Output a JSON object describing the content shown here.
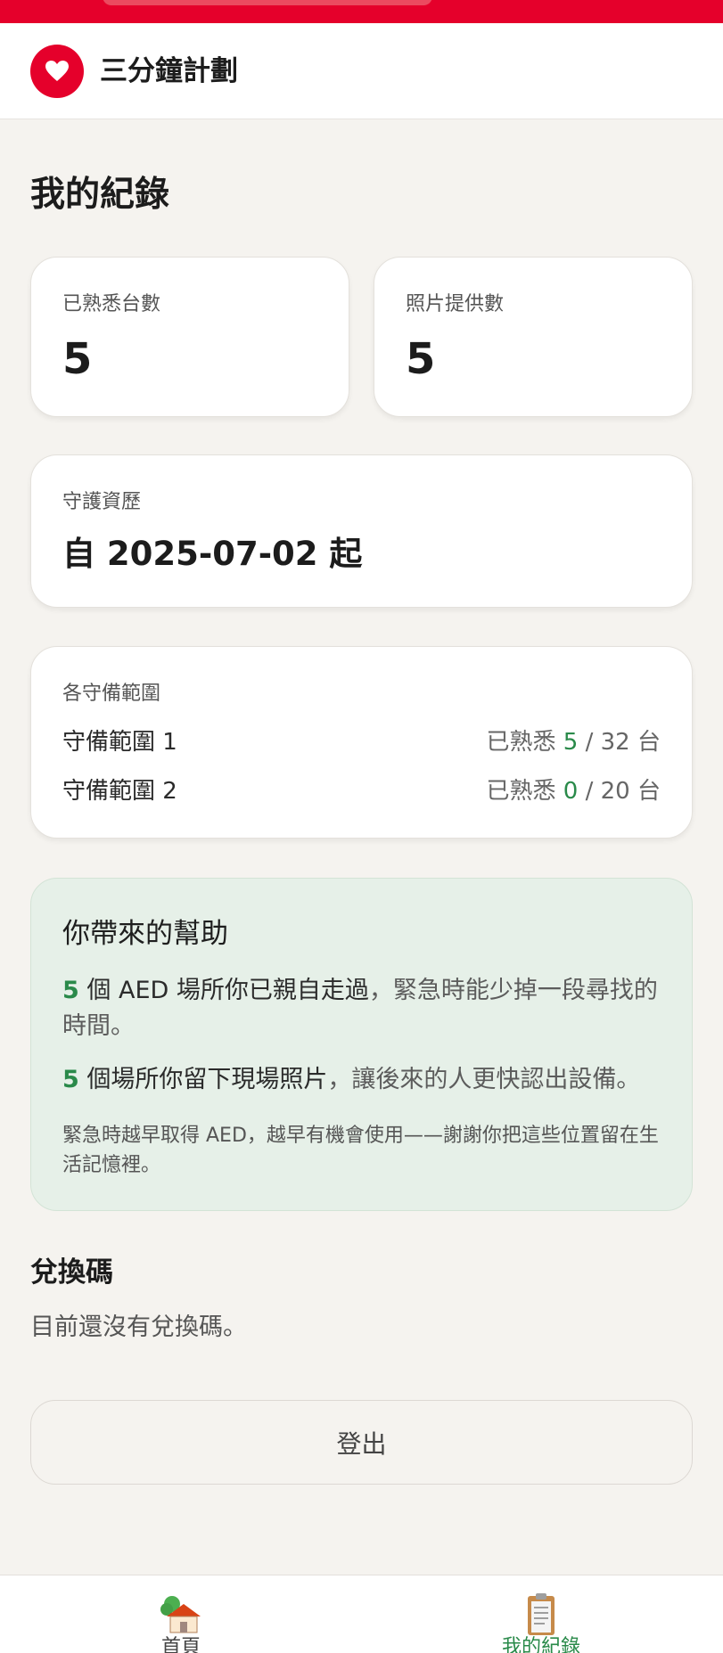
{
  "header": {
    "app_title": "三分鐘計劃"
  },
  "page": {
    "title": "我的紀錄"
  },
  "stats": {
    "familiar": {
      "label": "已熟悉台數",
      "value": "5"
    },
    "photos": {
      "label": "照片提供數",
      "value": "5"
    }
  },
  "guard": {
    "label": "守護資歷",
    "value": "自 2025-07-02 起"
  },
  "zones": {
    "label": "各守備範圍",
    "prefix": "已熟悉",
    "unit": "台",
    "items": [
      {
        "name": "守備範圍 1",
        "count": "5",
        "total": "/ 32"
      },
      {
        "name": "守備範圍 2",
        "count": "0",
        "total": "/ 20"
      }
    ]
  },
  "help": {
    "title": "你帶來的幫助",
    "line1": {
      "num": "5",
      "text_a": "個 AED 場所你已親自走過",
      "text_b": "，緊急時能少掉一段尋找的時間。"
    },
    "line2": {
      "num": "5",
      "text_a": "個場所你留下現場照片",
      "text_b": "，讓後來的人更快認出設備。"
    },
    "note": "緊急時越早取得 AED，越早有機會使用——謝謝你把這些位置留在生活記憶裡。"
  },
  "redeem": {
    "title": "兌換碼",
    "empty": "目前還沒有兌換碼。"
  },
  "logout_label": "登出",
  "nav": {
    "home": {
      "label": "首頁"
    },
    "records": {
      "label": "我的紀錄"
    }
  },
  "colors": {
    "brand": "#e5002b",
    "accent_green": "#2a8a4a",
    "help_bg": "#e6f0e8",
    "page_bg": "#f5f3ef"
  },
  "icons": {
    "logo": "heart-icon",
    "home": "house-icon",
    "records": "clipboard-icon"
  }
}
